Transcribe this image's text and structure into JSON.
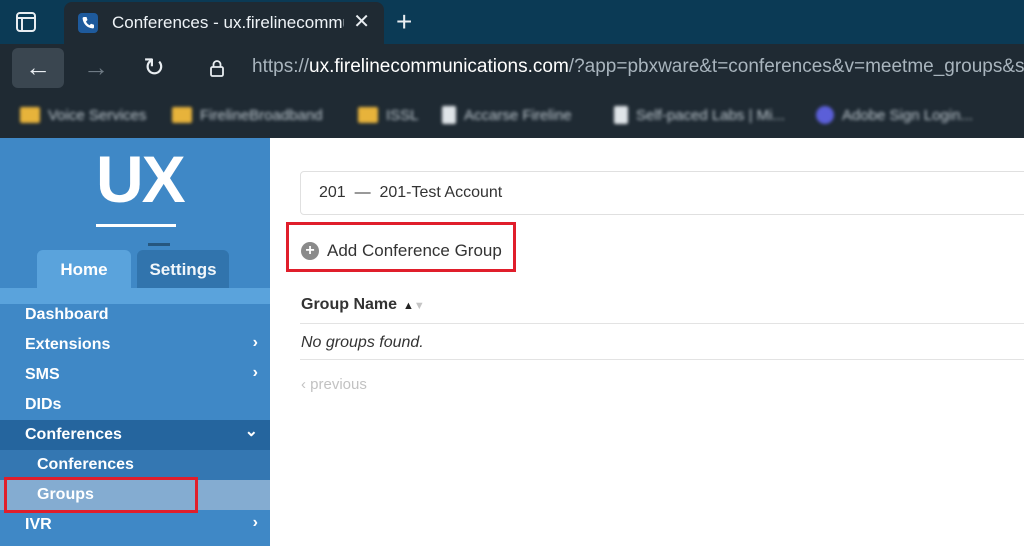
{
  "browser": {
    "tab_title": "Conferences - ux.firelinecommunications",
    "close_glyph": "✕",
    "new_tab_glyph": "+",
    "url_prefix": "https://",
    "url_host": "ux.firelinecommunications.com",
    "url_rest": "/?app=pbxware&t=conferences&v=meetme_groups&s",
    "back_glyph": "←",
    "forward_glyph": "→",
    "reload_glyph": "↻",
    "bookmarks": [
      "Voice Services",
      "FirelineBroadband",
      "ISSL",
      "Accarse Fireline",
      "Self-paced Labs | Mi...",
      "Adobe Sign Login..."
    ]
  },
  "sidebar": {
    "logo": "UX",
    "tabs": {
      "home": "Home",
      "settings": "Settings"
    },
    "items": {
      "dashboard": "Dashboard",
      "extensions": "Extensions",
      "sms": "SMS",
      "dids": "DIDs",
      "conferences": "Conferences",
      "sub_conferences": "Conferences",
      "sub_groups": "Groups",
      "ivr": "IVR"
    },
    "chevron_right": "›",
    "chevron_down": "⌄"
  },
  "main": {
    "account": "201  —  201-Test Account",
    "add_button": "Add Conference Group",
    "column_group_name": "Group Name",
    "empty_message": "No groups found.",
    "previous": "‹ previous"
  },
  "colors": {
    "sidebar": "#3f88c6",
    "highlight": "#e01e2b"
  }
}
